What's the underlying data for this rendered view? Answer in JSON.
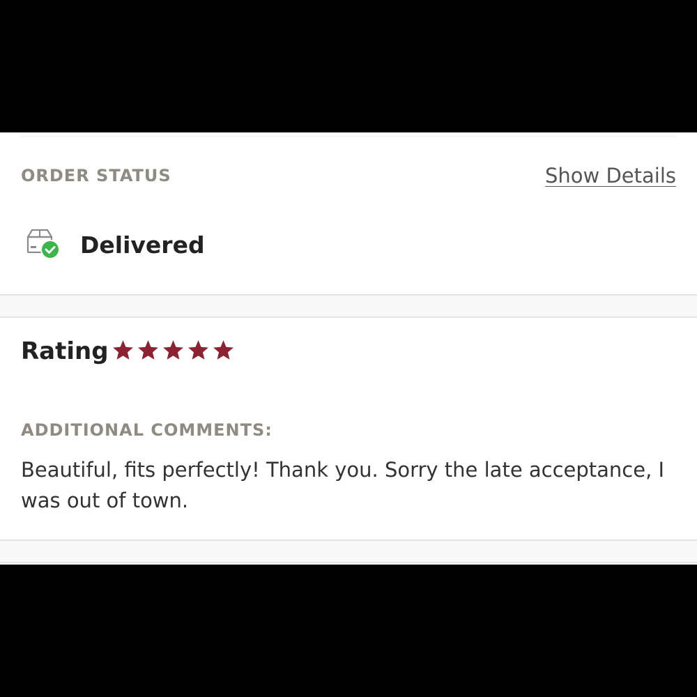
{
  "order_status": {
    "label": "ORDER STATUS",
    "show_details_label": "Show Details",
    "status": "Delivered",
    "status_icon": "delivered-box-check-icon",
    "check_color": "#3cb54a"
  },
  "rating": {
    "label": "Rating",
    "stars": 5,
    "max_stars": 5,
    "star_color": "#8b2333"
  },
  "comments": {
    "label": "ADDITIONAL COMMENTS:",
    "text": "Beautiful, fits perfectly! Thank you. Sorry the late acceptance, I was out of town."
  }
}
